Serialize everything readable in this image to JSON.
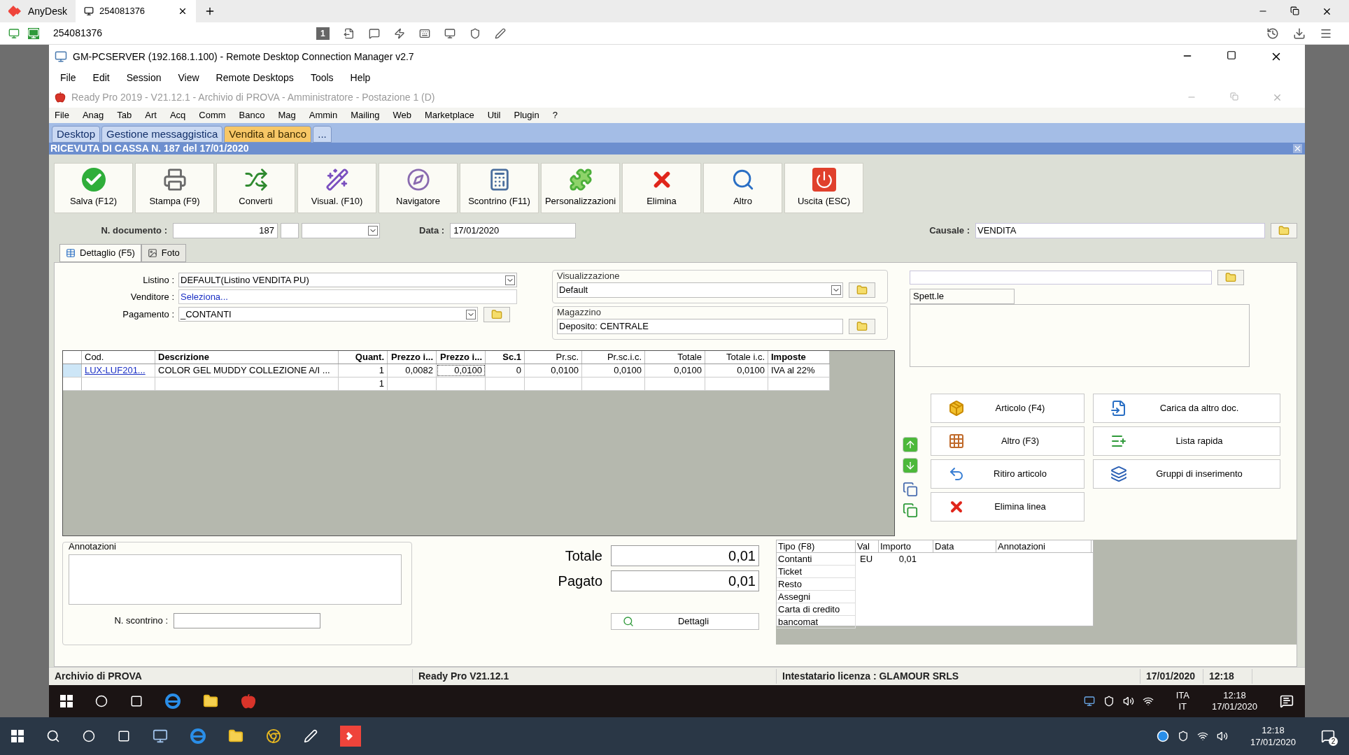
{
  "anydesk": {
    "app_label": "AnyDesk",
    "tab_label": "254081376",
    "address": "254081376",
    "toolbar_badge": "1"
  },
  "rdcm": {
    "title": "GM-PCSERVER (192.168.1.100) - Remote Desktop Connection Manager v2.7",
    "menu": [
      "File",
      "Edit",
      "Session",
      "View",
      "Remote Desktops",
      "Tools",
      "Help"
    ]
  },
  "app": {
    "title": "Ready Pro 2019 - V21.12.1 - Archivio di PROVA - Amministratore - Postazione 1 (D)",
    "menu": [
      "File",
      "Anag",
      "Tab",
      "Art",
      "Acq",
      "Comm",
      "Banco",
      "Mag",
      "Ammin",
      "Mailing",
      "Web",
      "Marketplace",
      "Util",
      "Plugin",
      "?"
    ],
    "tabs": [
      {
        "label": "Desktop",
        "selected": false
      },
      {
        "label": "Gestione messaggistica",
        "selected": false
      },
      {
        "label": "Vendita al banco",
        "selected": true
      },
      {
        "label": "...",
        "selected": false
      }
    ],
    "document_header": "RICEVUTA DI CASSA N. 187 del 17/01/2020",
    "toolbar": [
      {
        "label": "Salva (F12)",
        "kind": "save"
      },
      {
        "label": "Stampa (F9)",
        "kind": "print"
      },
      {
        "label": "Converti",
        "kind": "convert"
      },
      {
        "label": "Visual. (F10)",
        "kind": "wand"
      },
      {
        "label": "Navigatore",
        "kind": "compass"
      },
      {
        "label": "Scontrino (F11)",
        "kind": "register"
      },
      {
        "label": "Personalizzazioni",
        "kind": "puzzle"
      },
      {
        "label": "Elimina",
        "kind": "delete"
      },
      {
        "label": "Altro",
        "kind": "search"
      },
      {
        "label": "Uscita (ESC)",
        "kind": "exit"
      }
    ],
    "document": {
      "number_label": "N. documento :",
      "number": "187",
      "date_label": "Data :",
      "date": "17/01/2020",
      "causale_label": "Causale :",
      "causale": "VENDITA"
    },
    "detail_tabs": [
      {
        "label": "Dettaglio (F5)",
        "selected": true
      },
      {
        "label": "Foto",
        "selected": false
      }
    ],
    "form": {
      "listino_label": "Listino :",
      "listino": "DEFAULT(Listino VENDITA PU)",
      "venditore_label": "Venditore :",
      "venditore": "Seleziona...",
      "pagamento_label": "Pagamento :",
      "pagamento": "_CONTANTI",
      "visualizzazione_label": "Visualizzazione",
      "visualizzazione": "Default",
      "magazzino_label": "Magazzino",
      "magazzino": "Deposito: CENTRALE"
    },
    "customer": {
      "salutation": "Spett.le"
    },
    "grid": {
      "columns": [
        {
          "label": "Cod.",
          "bold": false
        },
        {
          "label": "Descrizione",
          "bold": true
        },
        {
          "label": "Quant.",
          "bold": true
        },
        {
          "label": "Prezzo i...",
          "bold": true
        },
        {
          "label": "Prezzo i...",
          "bold": true
        },
        {
          "label": "Sc.1",
          "bold": true
        },
        {
          "label": "Pr.sc.",
          "bold": false
        },
        {
          "label": "Pr.sc.i.c.",
          "bold": false
        },
        {
          "label": "Totale",
          "bold": false
        },
        {
          "label": "Totale i.c.",
          "bold": false
        },
        {
          "label": "Imposte",
          "bold": true
        }
      ],
      "rows": [
        {
          "cells": [
            "LUX-LUF201...",
            "COLOR GEL MUDDY COLLEZIONE A/I ...",
            "1",
            "0,0082",
            "0,0100",
            "0",
            "0,0100",
            "0,0100",
            "0,0100",
            "0,0100",
            "IVA al 22%"
          ]
        },
        {
          "cells": [
            null,
            null,
            "1",
            null,
            null,
            null,
            null,
            null,
            null,
            null,
            null
          ]
        }
      ]
    },
    "actions": [
      {
        "label": "Articolo (F4)",
        "kind": "box"
      },
      {
        "label": "Carica da altro doc.",
        "kind": "load"
      },
      {
        "label": "Altro (F3)",
        "kind": "grid"
      },
      {
        "label": "Lista rapida",
        "kind": "list"
      },
      {
        "label": "Ritiro articolo",
        "kind": "undo"
      },
      {
        "label": "Gruppi di inserimento",
        "kind": "group"
      },
      {
        "label": "Elimina linea",
        "kind": "delete"
      }
    ],
    "notes": {
      "title": "Annotazioni",
      "receipt_label": "N. scontrino :"
    },
    "totals": [
      {
        "label": "Totale",
        "value": "0,01"
      },
      {
        "label": "Pagato",
        "value": "0,01"
      }
    ],
    "details_button": "Dettagli",
    "payments": {
      "columns": [
        "Tipo (F8)",
        "Val",
        "Importo",
        "Data",
        "Annotazioni"
      ],
      "rows": [
        {
          "type": "Contanti",
          "currency": "EU",
          "amount": "0,01"
        },
        {
          "type": "Ticket"
        },
        {
          "type": "Resto"
        },
        {
          "type": "Assegni"
        },
        {
          "type": "Carta di credito"
        },
        {
          "type": "bancomat"
        }
      ]
    },
    "status_bar": [
      "Archivio di PROVA",
      "Ready Pro V21.12.1",
      "Intestatario licenza : GLAMOUR SRLS",
      "17/01/2020",
      "12:18"
    ]
  },
  "inner_taskbar": {
    "language": "ITA",
    "layout": "IT",
    "time": "12:18",
    "date": "17/01/2020"
  },
  "outer_taskbar": {
    "time": "12:18",
    "date": "17/01/2020",
    "notifications": "2"
  }
}
